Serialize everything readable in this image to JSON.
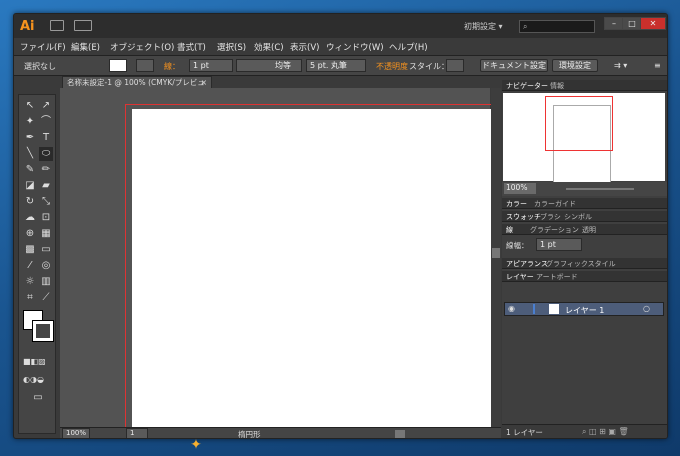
{
  "app": {
    "logo": "Ai",
    "workspace": "初期設定 ▾",
    "search_placeholder": ""
  },
  "window_controls": {
    "min": "–",
    "max": "□",
    "close": "✕"
  },
  "menu": [
    "ファイル(F)",
    "編集(E)",
    "オブジェクト(O)",
    "書式(T)",
    "選択(S)",
    "効果(C)",
    "表示(V)",
    "ウィンドウ(W)",
    "ヘルプ(H)"
  ],
  "control": {
    "selection": "選択なし",
    "stroke_label": "線：",
    "stroke_value": "1 pt",
    "profile": "均等",
    "brush": "5 pt. 丸筆",
    "opacity": "不透明度",
    "style": "スタイル：",
    "doc_setup": "ドキュメント設定",
    "prefs": "環境設定"
  },
  "document": {
    "tab_title": "名称未設定-1 @ 100% (CMYK/プレビュー)",
    "tab_close": "×"
  },
  "statusbar": {
    "zoom": "100%",
    "page": "1",
    "tool": "楕円形"
  },
  "panels": {
    "navigator_tabs": [
      "ナビゲーター",
      "情報"
    ],
    "navigator_zoom": "100%",
    "color_tabs": [
      "カラー",
      "カラーガイド"
    ],
    "swatch_tabs": [
      "スウォッチ",
      "ブラシ",
      "シンボル"
    ],
    "stroke_tabs": [
      "線",
      "グラデーション",
      "透明"
    ],
    "stroke_width_label": "線幅：",
    "stroke_width_value": "1 pt",
    "appearance_tabs": [
      "アピアランス",
      "グラフィックスタイル"
    ],
    "layer_tabs": [
      "レイヤー",
      "アートボード"
    ],
    "layer_name": "レイヤー 1",
    "layer_count": "1 レイヤー"
  }
}
